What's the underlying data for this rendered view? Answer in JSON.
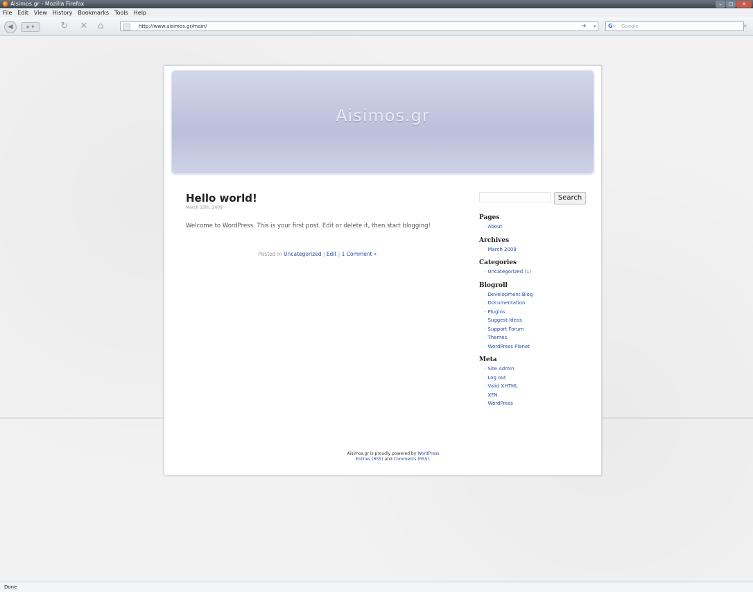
{
  "browser": {
    "title": "Aisimos.gr - Mozilla Firefox",
    "menu": [
      "File",
      "Edit",
      "View",
      "History",
      "Bookmarks",
      "Tools",
      "Help"
    ],
    "url": "http://www.aisimos.gr/main/",
    "search_placeholder": "Google",
    "status": "Done"
  },
  "site": {
    "title": "Aisimos.gr"
  },
  "post": {
    "title": "Hello world!",
    "date": "March 15th, 2009",
    "body": "Welcome to WordPress. This is your first post. Edit or delete it, then start blogging!",
    "meta_prefix": "Posted in",
    "category_link": "Uncategorized",
    "sep1": " | ",
    "edit_link": "Edit",
    "sep2": " | ",
    "comments_link": "1 Comment »"
  },
  "sidebar": {
    "search_button": "Search",
    "sections": [
      {
        "heading": "Pages",
        "items": [
          "About"
        ]
      },
      {
        "heading": "Archives",
        "items": [
          "March 2009"
        ]
      },
      {
        "heading": "Categories",
        "items": [
          "Uncategorized"
        ],
        "count": "(1)"
      },
      {
        "heading": "Blogroll",
        "items": [
          "Development Blog",
          "Documentation",
          "Plugins",
          "Suggest Ideas",
          "Support Forum",
          "Themes",
          "WordPress Planet"
        ]
      },
      {
        "heading": "Meta",
        "items": [
          "Site Admin",
          "Log out",
          "Valid XHTML",
          "XFN",
          "WordPress"
        ]
      }
    ]
  },
  "footer": {
    "text1": "Aisimos.gr is proudly powered by",
    "link1": "WordPress",
    "link2": "Entries (RSS)",
    "and": "and",
    "link3": "Comments (RSS)."
  },
  "icons": {
    "back": "back-arrow-icon",
    "reload": "reload-icon",
    "stop": "stop-icon",
    "home": "home-icon",
    "go": "go-arrow-icon",
    "search": "magnifier-icon"
  }
}
